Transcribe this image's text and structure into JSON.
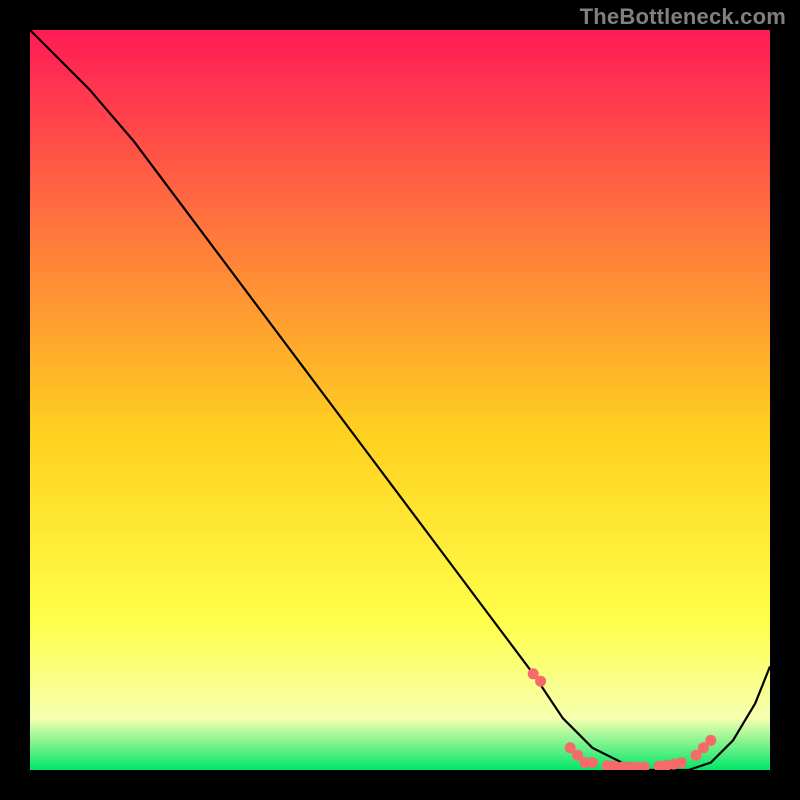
{
  "watermark": "TheBottleneck.com",
  "chart_data": {
    "type": "line",
    "title": "",
    "xlabel": "",
    "ylabel": "",
    "xlim": [
      0,
      100
    ],
    "ylim": [
      0,
      100
    ],
    "gradient_colors": {
      "top": "#ff1a56",
      "upper_mid": "#ff7a3c",
      "mid": "#ffd21f",
      "lower_mid": "#ffff4a",
      "low": "#f6ffb0",
      "bottom": "#00e768"
    },
    "series": [
      {
        "name": "curve",
        "x": [
          0,
          8,
          14,
          20,
          26,
          32,
          38,
          44,
          50,
          56,
          62,
          68,
          72,
          76,
          80,
          83,
          86,
          89,
          92,
          95,
          98,
          100
        ],
        "y": [
          100,
          92,
          85,
          77,
          69,
          61,
          53,
          45,
          37,
          29,
          21,
          13,
          7,
          3,
          1,
          0,
          0,
          0,
          1,
          4,
          9,
          14
        ]
      }
    ],
    "markers": {
      "name": "highlight-dots",
      "color": "#f66a6a",
      "x": [
        68,
        69,
        73,
        74,
        75,
        76,
        78,
        79,
        80,
        81,
        82,
        83,
        85,
        86,
        87,
        88,
        90,
        91,
        92
      ],
      "y": [
        13,
        12,
        3,
        2,
        1,
        1,
        0.6,
        0.5,
        0.4,
        0.4,
        0.4,
        0.4,
        0.5,
        0.6,
        0.8,
        1,
        2,
        3,
        4
      ]
    }
  }
}
